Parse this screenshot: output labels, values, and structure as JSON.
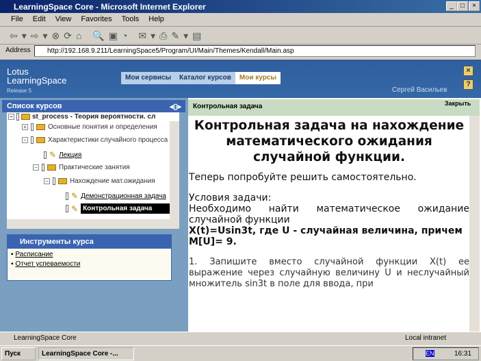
{
  "window": {
    "title": "LearningSpace Core - Microsoft Internet Explorer"
  },
  "menu": [
    "File",
    "Edit",
    "View",
    "Favorites",
    "Tools",
    "Help"
  ],
  "address": {
    "label": "Address",
    "url": "http://192.168.9.211/LearningSpace5/Program/UI/Main/Themes/Kendall/Main.asp"
  },
  "header": {
    "logo_line1": "Lotus",
    "logo_line2": "LearningSpace",
    "logo_release": "Release 5",
    "nav": [
      "Мои сервисы",
      "Каталог курсов",
      "Мои курсы"
    ],
    "user": "Сергей Васильев"
  },
  "left": {
    "title": "Список курсов",
    "tree": [
      "st_process - Теория вероятности. сл",
      "Основные понятия и определения",
      "Характеристики случайного процесса",
      "Лекция",
      "Практические занятия",
      "Нахождение мат.ожидания",
      "Демонстрационная задача",
      "Контрольная задача"
    ],
    "tools_title": "Инструменты курса",
    "tools": [
      "Расписание",
      "Отчет успеваемости"
    ]
  },
  "content": {
    "header": "Контрольная задача",
    "close": "Закрыть",
    "heading": "Контрольная задача на нахождение математического ожидания случайной функции.",
    "intro": "Теперь попробуйте решить самостоятельно.",
    "cond_title": "Условия задачи:",
    "cond1": "Необходимо найти математическое ожидание случайной функции",
    "cond2": "X(t)=Usin3t, где U - случайная величина, причем",
    "cond3": "M[U]= 9.",
    "step1": "1. Запишите вместо случайной функции X(t) ее выражение через случайную величину U и неслучайный множитель sin3t в поле для ввода, при"
  },
  "status": {
    "text": "LearningSpace Core",
    "zone": "Local intranet"
  },
  "taskbar": {
    "start": "Пуск",
    "task": "LearningSpace Core -...",
    "lang": "EN",
    "clock": "16:31"
  }
}
